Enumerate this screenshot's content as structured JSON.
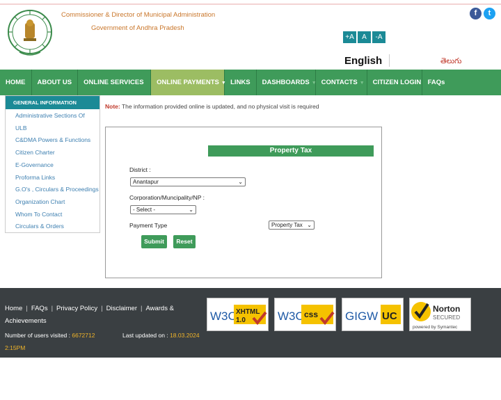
{
  "header": {
    "title": "Commissioner & Director of Municipal Administration",
    "subtitle": "Government of Andhra Pradesh",
    "font_sizes": [
      "+A",
      "A",
      "-A"
    ],
    "lang_english": "English",
    "lang_telugu": "తెలుగు"
  },
  "nav": {
    "items": [
      {
        "label": "HOME"
      },
      {
        "label": "ABOUT US"
      },
      {
        "label": "ONLINE SERVICES"
      },
      {
        "label": "ONLINE PAYMENTS"
      },
      {
        "label": "LINKS"
      },
      {
        "label": "DASHBOARDS"
      },
      {
        "label": "CONTACTS"
      },
      {
        "label": "CITIZEN LOGIN"
      },
      {
        "label": "FAQs"
      }
    ]
  },
  "sidebar": {
    "heading": "GENERAL INFORMATION",
    "items": [
      "Administrative Sections Of",
      "ULB",
      "C&DMA Powers & Functions",
      "Citizen Charter",
      "E-Governance",
      "Proforma Links",
      "G.O's , Circulars & Proceedings",
      "Organization Chart",
      "Whom To Contact",
      "Circulars & Orders"
    ]
  },
  "note": {
    "prefix": "Note:",
    "text": " The information provided online is updated, and no physical visit is required"
  },
  "form": {
    "title": "Property Tax",
    "district_label": "District :",
    "district_value": "Anantapur",
    "corp_label": "Corporation/Muncipality/NP :",
    "corp_value": "- Select -",
    "payment_label": "Payment Type",
    "payment_value": "Property Tax",
    "submit": "Submit",
    "reset": "Reset"
  },
  "footer": {
    "links": [
      "Home",
      "FAQs",
      "Privacy Policy",
      "Disclaimer",
      "Awards &",
      "Achievements"
    ],
    "visits_label": "Number of users visited : ",
    "visits_value": "6672712",
    "updated_label": "Last updated on : ",
    "updated_value": "18.03.2024",
    "time": "2:15PM",
    "badges": {
      "xhtml": {
        "w3c": "W3C",
        "name": "XHTML",
        "ver": "1.0"
      },
      "css": {
        "w3c": "W3C",
        "name": "css"
      },
      "gigw": {
        "name": "GIGW",
        "suffix": "UC"
      },
      "norton": {
        "name": "Norton",
        "sub": "SECURED",
        "powered": "powered by Symantec"
      }
    }
  },
  "colors": {
    "nav": "#3f9b5a",
    "nav_active": "#9cbd63",
    "teal": "#1b8a96",
    "footer": "#3a3f42"
  }
}
